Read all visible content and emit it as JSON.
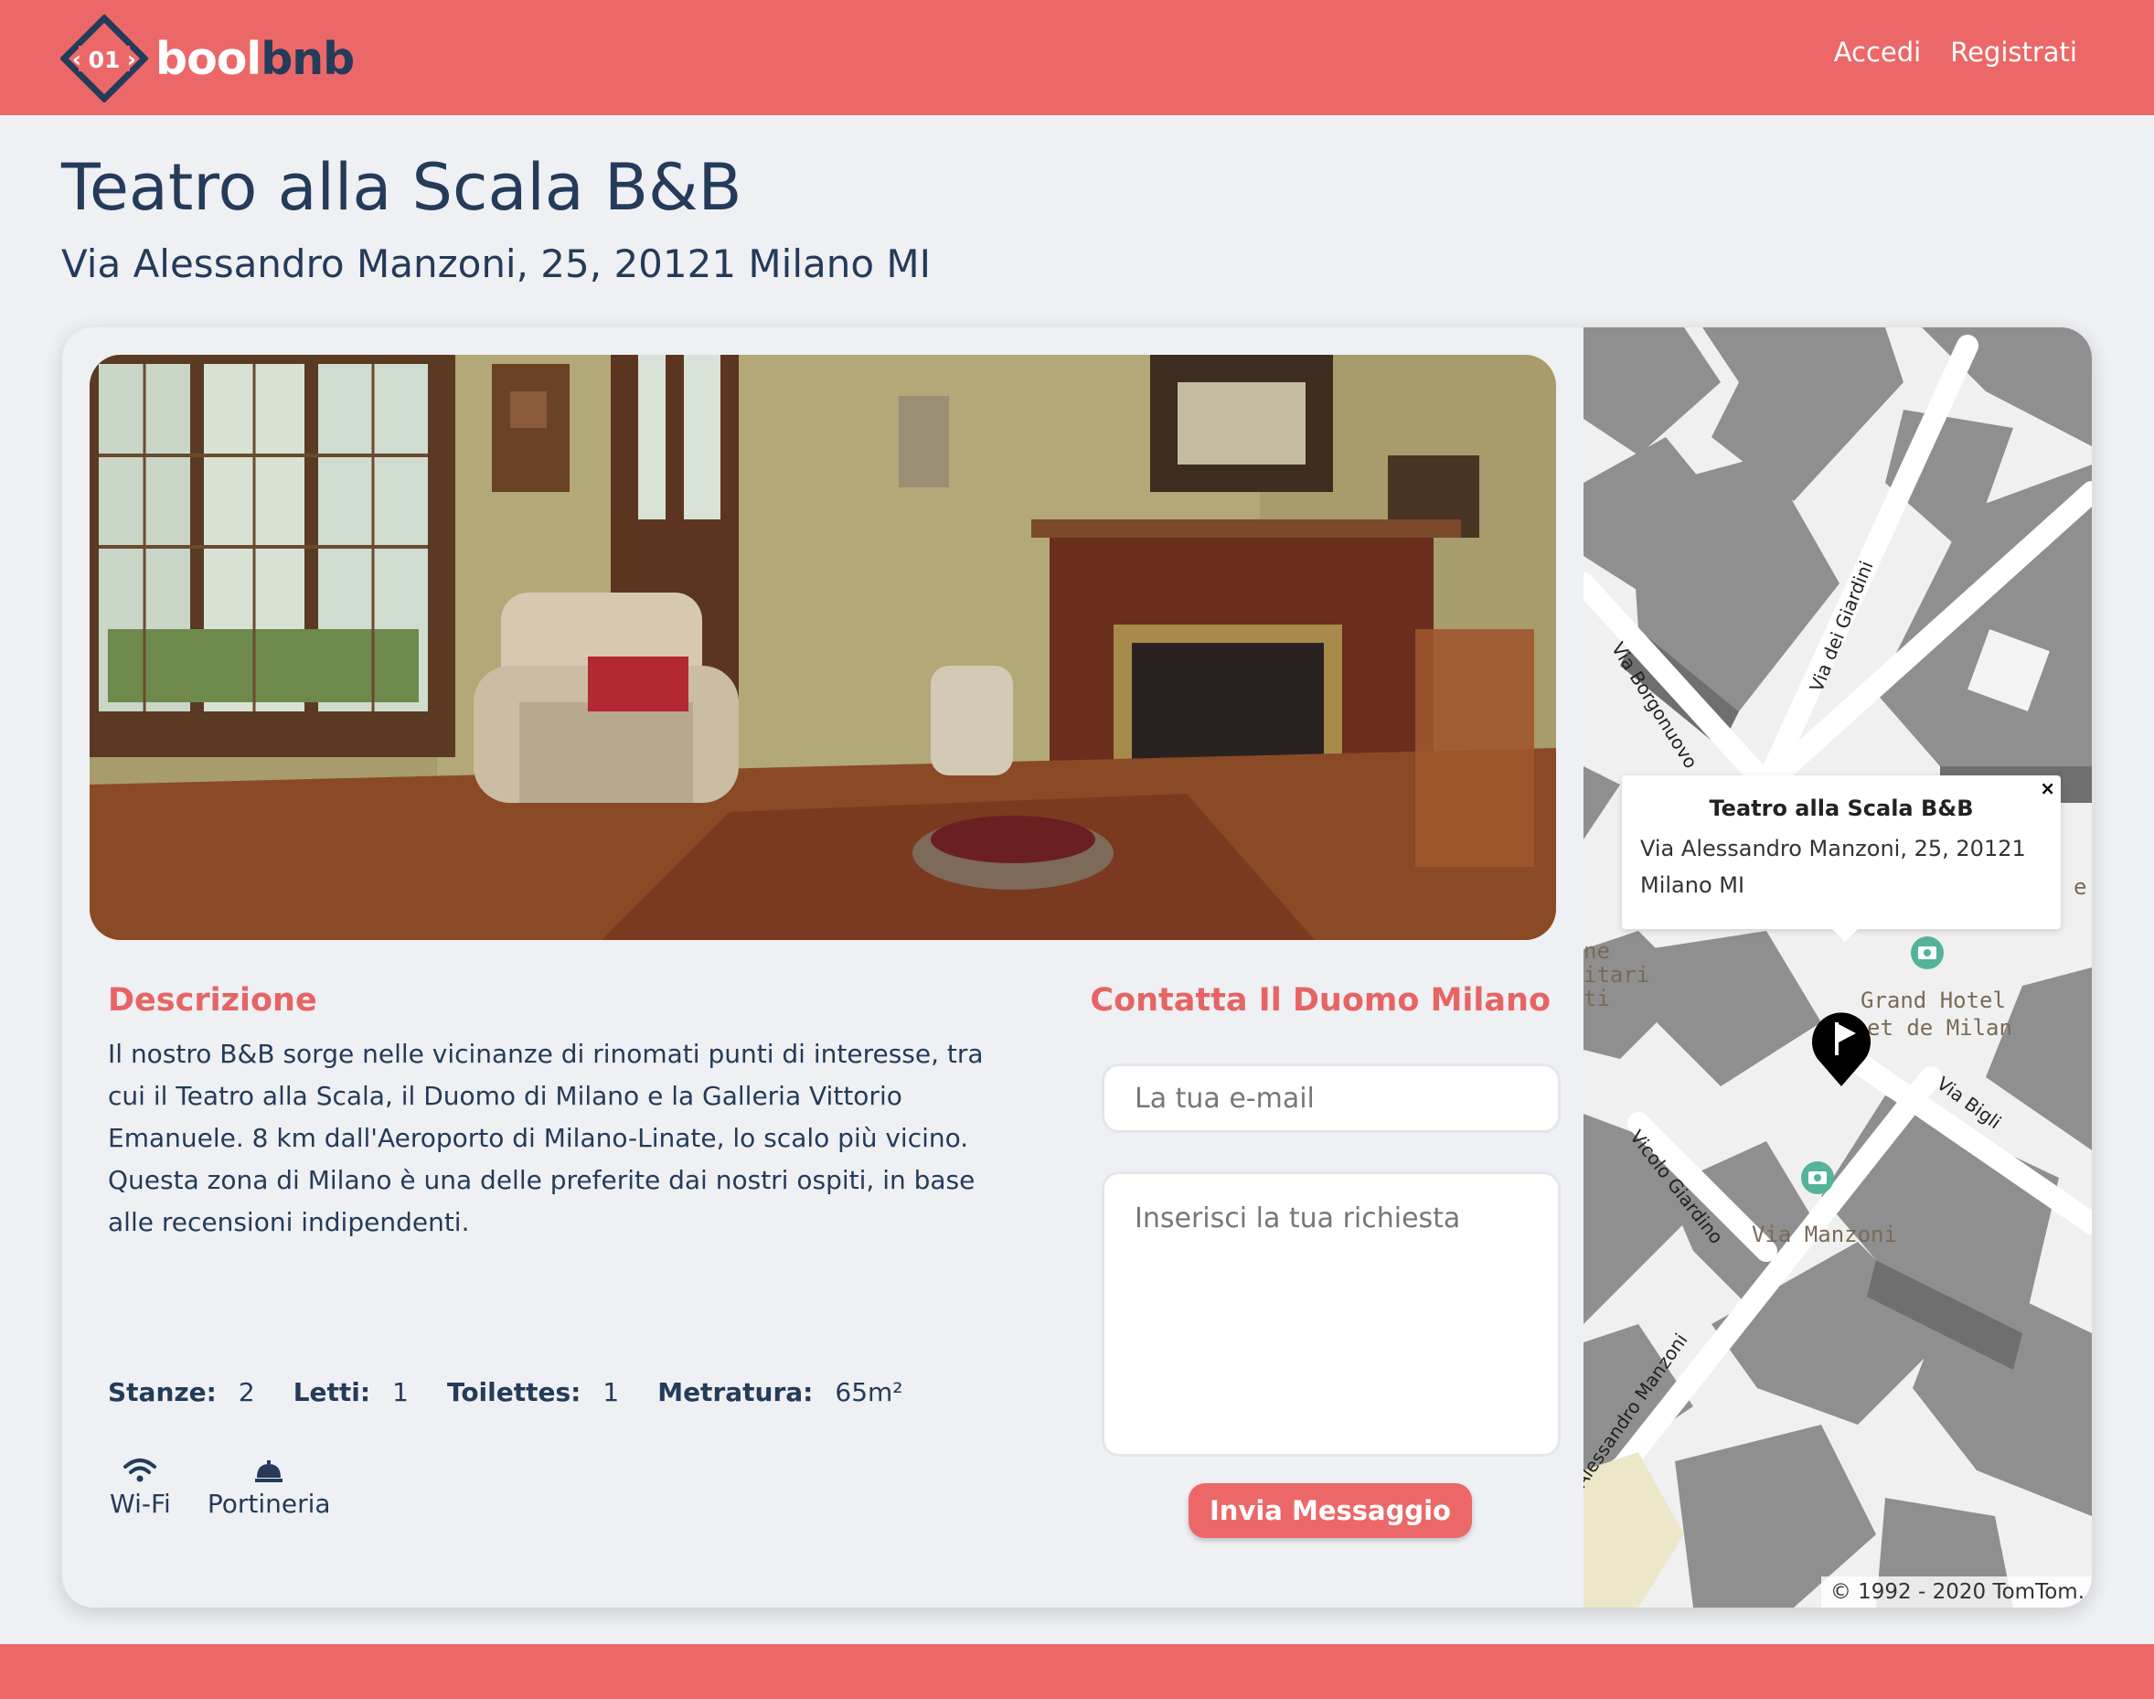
{
  "brand": {
    "logo_badge": "01",
    "name_part1": "bool",
    "name_part2": "bnb",
    "primary_color": "#ec6868",
    "secondary_color": "#243b5a"
  },
  "nav": {
    "login_label": "Accedi",
    "register_label": "Registrati"
  },
  "listing": {
    "title": "Teatro alla Scala B&B",
    "address": "Via Alessandro Manzoni, 25, 20121 Milano MI",
    "photo_icon": "living-room-photo"
  },
  "description": {
    "heading": "Descrizione",
    "text": "Il nostro B&B sorge nelle vicinanze di rinomati punti di interesse, tra cui il Teatro alla Scala, il Duomo di Milano e la Galleria Vittorio Emanuele. 8 km dall'Aeroporto di Milano-Linate, lo scalo più vicino. Questa zona di Milano è una delle preferite dai nostri ospiti, in base alle recensioni indipendenti."
  },
  "stats": [
    {
      "label": "Stanze:",
      "value": "2"
    },
    {
      "label": "Letti:",
      "value": "1"
    },
    {
      "label": "Toilettes:",
      "value": "1"
    },
    {
      "label": "Metratura:",
      "value": "65m²"
    }
  ],
  "amenities": [
    {
      "label": "Wi-Fi",
      "icon": "wifi-icon"
    },
    {
      "label": "Portineria",
      "icon": "concierge-bell-icon"
    }
  ],
  "contact": {
    "heading": "Contatta Il Duomo Milano",
    "email_placeholder": "La tua e-mail",
    "message_placeholder": "Inserisci la tua richiesta",
    "submit_label": "Invia Messaggio"
  },
  "map": {
    "popup_title": "Teatro alla Scala B&B",
    "popup_address": "Via Alessandro Manzoni, 25, 20121 Milano MI",
    "popup_close": "×",
    "attribution": "© 1992 - 2020 TomTom.",
    "street_labels": {
      "borgonuovo": "Via Borgonuovo",
      "giardini": "Via dei Giardini",
      "bigli": "Via Bigli",
      "vicolo": "Vicolo Giardino",
      "manzoni": "Via Manzoni",
      "manzoni_long": "Alessandro Manzoni",
      "hotel_line1": "Grand Hotel",
      "hotel_line2": "et de Milan",
      "edge_line1": "ne",
      "edge_line2": "itari",
      "edge_line3": "ti",
      "edge_e": "e"
    }
  }
}
